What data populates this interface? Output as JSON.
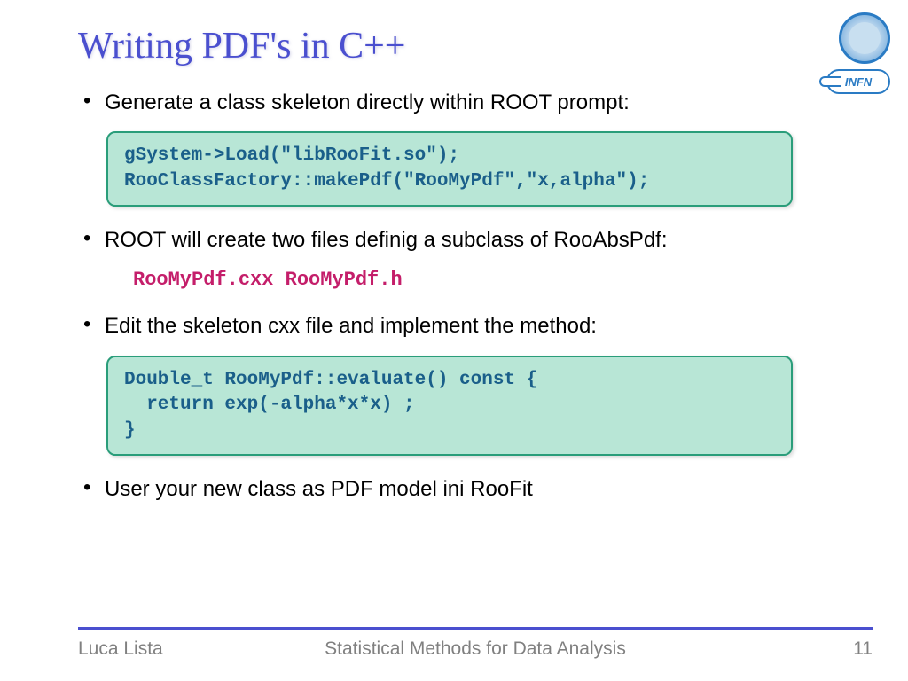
{
  "title": "Writing PDF's in C++",
  "bullets": {
    "b1": "Generate a class skeleton directly within ROOT prompt:",
    "b2": "ROOT will create two files definig a subclass of RooAbsPdf:",
    "b3": "Edit the skeleton cxx file and implement the method:",
    "b4": "User your new class as PDF model ini RooFit"
  },
  "code1": "gSystem->Load(\"libRooFit.so\");\nRooClassFactory::makePdf(\"RooMyPdf\",\"x,alpha\");",
  "code_inline": "RooMyPdf.cxx  RooMyPdf.h",
  "code2": "Double_t RooMyPdf::evaluate() const {\n  return exp(-alpha*x*x) ;\n}",
  "logos": {
    "infn_text": "INFN"
  },
  "footer": {
    "author": "Luca Lista",
    "title": "Statistical Methods for Data Analysis",
    "page": "11"
  }
}
